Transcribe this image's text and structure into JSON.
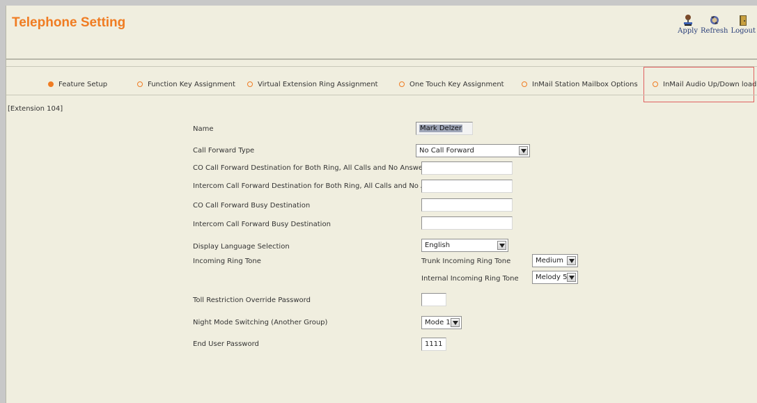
{
  "app": {
    "title": "Telephone Setting"
  },
  "toolbar": {
    "apply": "Apply",
    "refresh": "Refresh",
    "logout": "Logout"
  },
  "tabs": [
    {
      "label": "Feature Setup",
      "active": true
    },
    {
      "label": "Function Key Assignment",
      "active": false
    },
    {
      "label": "Virtual Extension Ring Assignment",
      "active": false
    },
    {
      "label": "One Touch Key Assignment",
      "active": false
    },
    {
      "label": "InMail Station Mailbox Options",
      "active": false
    },
    {
      "label": "InMail Audio Up/Down load",
      "active": false
    }
  ],
  "extension_label": "[Extension 104]",
  "form": {
    "name": {
      "label": "Name",
      "value": "Mark Delzer"
    },
    "call_forward_type": {
      "label": "Call Forward Type",
      "value": "No Call Forward"
    },
    "co_cf_dest": {
      "label": "CO Call Forward Destination for Both Ring, All Calls and No Answer",
      "value": ""
    },
    "ic_cf_dest": {
      "label": "Intercom Call Forward Destination for Both Ring, All Calls and No Answer",
      "value": ""
    },
    "co_cf_busy": {
      "label": "CO Call Forward Busy Destination",
      "value": ""
    },
    "ic_cf_busy": {
      "label": "Intercom Call Forward Busy Destination",
      "value": ""
    },
    "display_language": {
      "label": "Display Language Selection",
      "value": "English"
    },
    "incoming_ring_tone": {
      "label": "Incoming Ring Tone",
      "trunk_label": "Trunk Incoming Ring Tone",
      "trunk_value": "Medium",
      "internal_label": "Internal Incoming Ring Tone",
      "internal_value": "Melody 5"
    },
    "toll_override": {
      "label": "Toll Restriction Override Password",
      "value": ""
    },
    "night_mode": {
      "label": "Night Mode Switching (Another Group)",
      "value": "Mode 1"
    },
    "end_user_password": {
      "label": "End User Password",
      "value": "1111"
    }
  },
  "colors": {
    "accent": "#f07c22",
    "background": "#f0eedf",
    "highlight_border": "#e06060"
  }
}
